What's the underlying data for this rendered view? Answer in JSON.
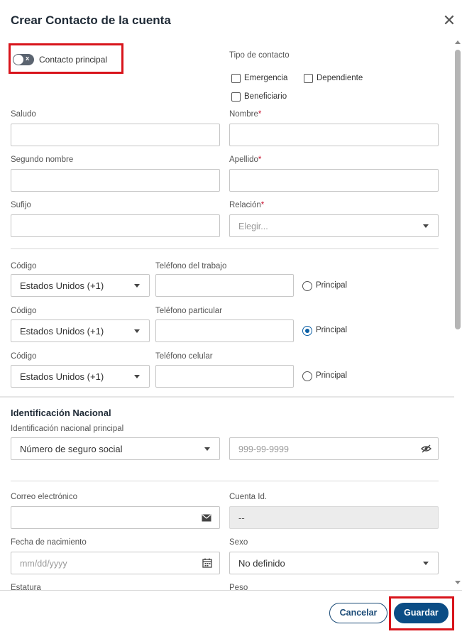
{
  "dialog": {
    "title": "Crear Contacto de la cuenta",
    "close_icon": "close-icon"
  },
  "primary_contact": {
    "label": "Contacto principal",
    "toggle_state": "off",
    "toggle_glyph": "x"
  },
  "contact_type": {
    "label": "Tipo de contacto",
    "options": [
      {
        "label": "Emergencia",
        "checked": false
      },
      {
        "label": "Dependiente",
        "checked": false
      },
      {
        "label": "Beneficiario",
        "checked": false
      }
    ]
  },
  "fields": {
    "saludo": {
      "label": "Saludo",
      "value": ""
    },
    "nombre": {
      "label": "Nombre",
      "required": "*",
      "value": ""
    },
    "segundo_nombre": {
      "label": "Segundo nombre",
      "value": ""
    },
    "apellido": {
      "label": "Apellido",
      "required": "*",
      "value": ""
    },
    "sufijo": {
      "label": "Sufijo",
      "value": ""
    },
    "relacion": {
      "label": "Relación",
      "required": "*",
      "placeholder": "Elegir..."
    }
  },
  "phones": [
    {
      "code_label": "Código",
      "code_value": "Estados Unidos (+1)",
      "phone_label": "Teléfono del trabajo",
      "value": "",
      "primary_label": "Principal",
      "primary": false
    },
    {
      "code_label": "Código",
      "code_value": "Estados Unidos (+1)",
      "phone_label": "Teléfono particular",
      "value": "",
      "primary_label": "Principal",
      "primary": true
    },
    {
      "code_label": "Código",
      "code_value": "Estados Unidos (+1)",
      "phone_label": "Teléfono celular",
      "value": "",
      "primary_label": "Principal",
      "primary": false
    }
  ],
  "national_id": {
    "section_title": "Identificación Nacional",
    "type_label": "Identificación nacional principal",
    "type_value": "Número de seguro social",
    "number_placeholder": "999-99-9999"
  },
  "email": {
    "label": "Correo electrónico",
    "value": ""
  },
  "account_id": {
    "label": "Cuenta Id.",
    "value": "--"
  },
  "birthdate": {
    "label": "Fecha de nacimiento",
    "placeholder": "mm/dd/yyyy"
  },
  "sex": {
    "label": "Sexo",
    "value": "No definido"
  },
  "height": {
    "label": "Estatura"
  },
  "weight": {
    "label": "Peso"
  },
  "footer": {
    "cancel_label": "Cancelar",
    "save_label": "Guardar"
  },
  "colors": {
    "primary": "#0b4d85",
    "highlight": "#d8141b",
    "required": "#c8102e"
  }
}
